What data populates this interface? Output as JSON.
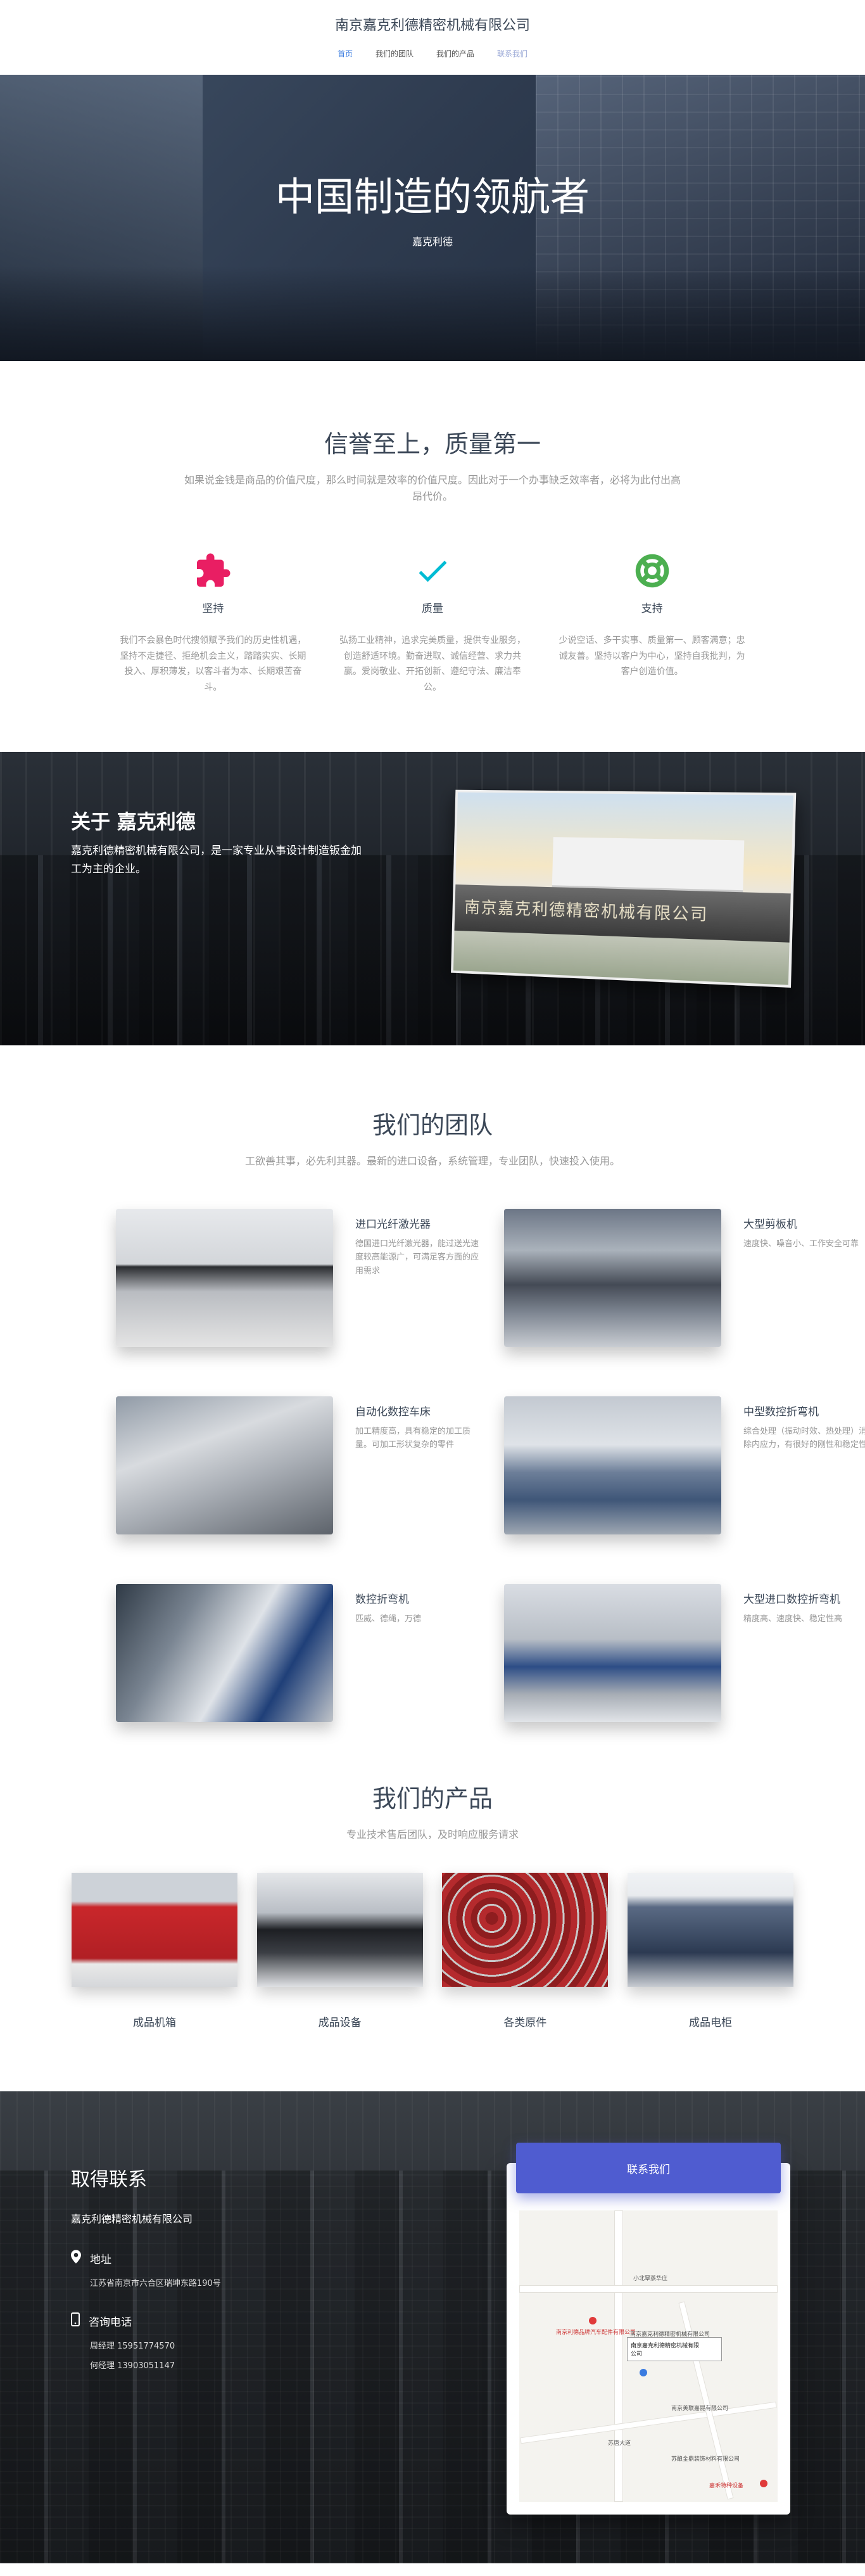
{
  "header": {
    "site_title": "南京嘉克利德精密机械有限公司",
    "nav": [
      {
        "label": "首页"
      },
      {
        "label": "我们的团队"
      },
      {
        "label": "我们的产品"
      },
      {
        "label": "联系我们"
      }
    ]
  },
  "hero": {
    "title": "中国制造的领航者",
    "subtitle": "嘉克利德"
  },
  "features": {
    "title": "信誉至上，质量第一",
    "desc": "如果说金钱是商品的价值尺度，那么时间就是效率的价值尺度。因此对于一个办事缺乏效率者，必将为此付出高昂代价。",
    "items": [
      {
        "title": "坚持",
        "icon": "puzzle-icon",
        "text": "我们不会暴色时代搜领赋予我们的历史性机遇，坚持不走捷径、拒绝机会主义，踏踏实实、长期投入、厚积薄发，以客斗者为本、长期艰苦奋斗。"
      },
      {
        "title": "质量",
        "icon": "check-icon",
        "text": "弘扬工业精神，追求完美质量，提供专业服务，创造舒适环境。勤奋进取、诚信经营、求力共赢。爱岗敬业、开拓创新、遵纪守法、廉洁奉公。"
      },
      {
        "title": "支持",
        "icon": "lifebuoy-icon",
        "text": "少说空话、多干实事、质量第一、顾客满意；忠诚友善。坚持以客户为中心，坚持自我批判，为客户创造价值。"
      }
    ]
  },
  "about": {
    "title": "关于 嘉克利德",
    "text": "嘉克利德精密机械有限公司，是一家专业从事设计制造钣金加工为主的企业。",
    "sign": "南京嘉克利德精密机械有限公司"
  },
  "team": {
    "title": "我们的团队",
    "desc": "工欲善其事，必先利其器。最新的进口设备，系统管理，专业团队，快速投入使用。",
    "items": [
      {
        "title": "进口光纤激光器",
        "text": "德国进口光纤激光器，能过送光速度较高能源广，可满足客方面的应用需求"
      },
      {
        "title": "大型剪板机",
        "text": "速度快、噪音小、工作安全可靠"
      },
      {
        "title": "自动化数控车床",
        "text": "加工精度高，具有稳定的加工质量。可加工形状复杂的零件"
      },
      {
        "title": "中型数控折弯机",
        "text": "综合处理（振动时效、热处理）消除内应力，有很好的刚性和稳定性"
      },
      {
        "title": "数控折弯机",
        "text": "匹威、德绳，万德"
      },
      {
        "title": "大型进口数控折弯机",
        "text": "精度高、速度快、稳定性高"
      }
    ]
  },
  "products": {
    "title": "我们的产品",
    "desc": "专业技术售后团队，及时响应服务请求",
    "items": [
      {
        "label": "成品机箱"
      },
      {
        "label": "成品设备"
      },
      {
        "label": "各类原件"
      },
      {
        "label": "成品电柜"
      }
    ]
  },
  "contact": {
    "title": "取得联系",
    "company": "嘉克利德精密机械有限公司",
    "address_label": "地址",
    "address": "江苏省南京市六合区瑞坤东路190号",
    "phone_label": "咨询电话",
    "phone1": "周经理 15951774570",
    "phone2": "何经理 13903051147",
    "button_label": "联系我们",
    "map": {
      "popup_line1": "南京嘉克利德精密机械有限",
      "popup_line2": "公司",
      "label_a": "小北覃蒸华庄",
      "label_b": "南京利德品牌汽车配件有限公司",
      "label_c": "南京嘉克利德精密机械有限公司",
      "label_d": "南京美联嘉昆有限公司",
      "label_e": "苏酿金鼎装饰材料有限公司",
      "label_f": "苏唐大道",
      "label_g": "嘉禾特种设备"
    }
  },
  "colors": {
    "accent": "#4f5cd0",
    "puzzle": "#e91e63",
    "check": "#00bcd4",
    "lifebuoy": "#4caf50"
  }
}
